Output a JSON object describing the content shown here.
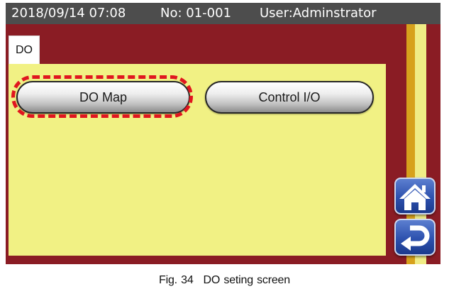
{
  "status_bar": {
    "datetime": "2018/09/14 07:08",
    "number": "No: 01-001",
    "user": "User:Adminstrator"
  },
  "tab": {
    "label": "DO"
  },
  "buttons": {
    "do_map": "DO Map",
    "control_io": "Control I/O"
  },
  "nav": {
    "home_icon": "home-icon",
    "return_icon": "return-arrow-icon"
  },
  "caption": {
    "figure": "Fig. 34",
    "title": "DO seting screen"
  },
  "colors": {
    "frame": "#8a1c24",
    "title_bar": "#4d4d4d",
    "panel": "#f1f184",
    "highlight": "#e0161f",
    "nav_button": "#2d51ae"
  }
}
